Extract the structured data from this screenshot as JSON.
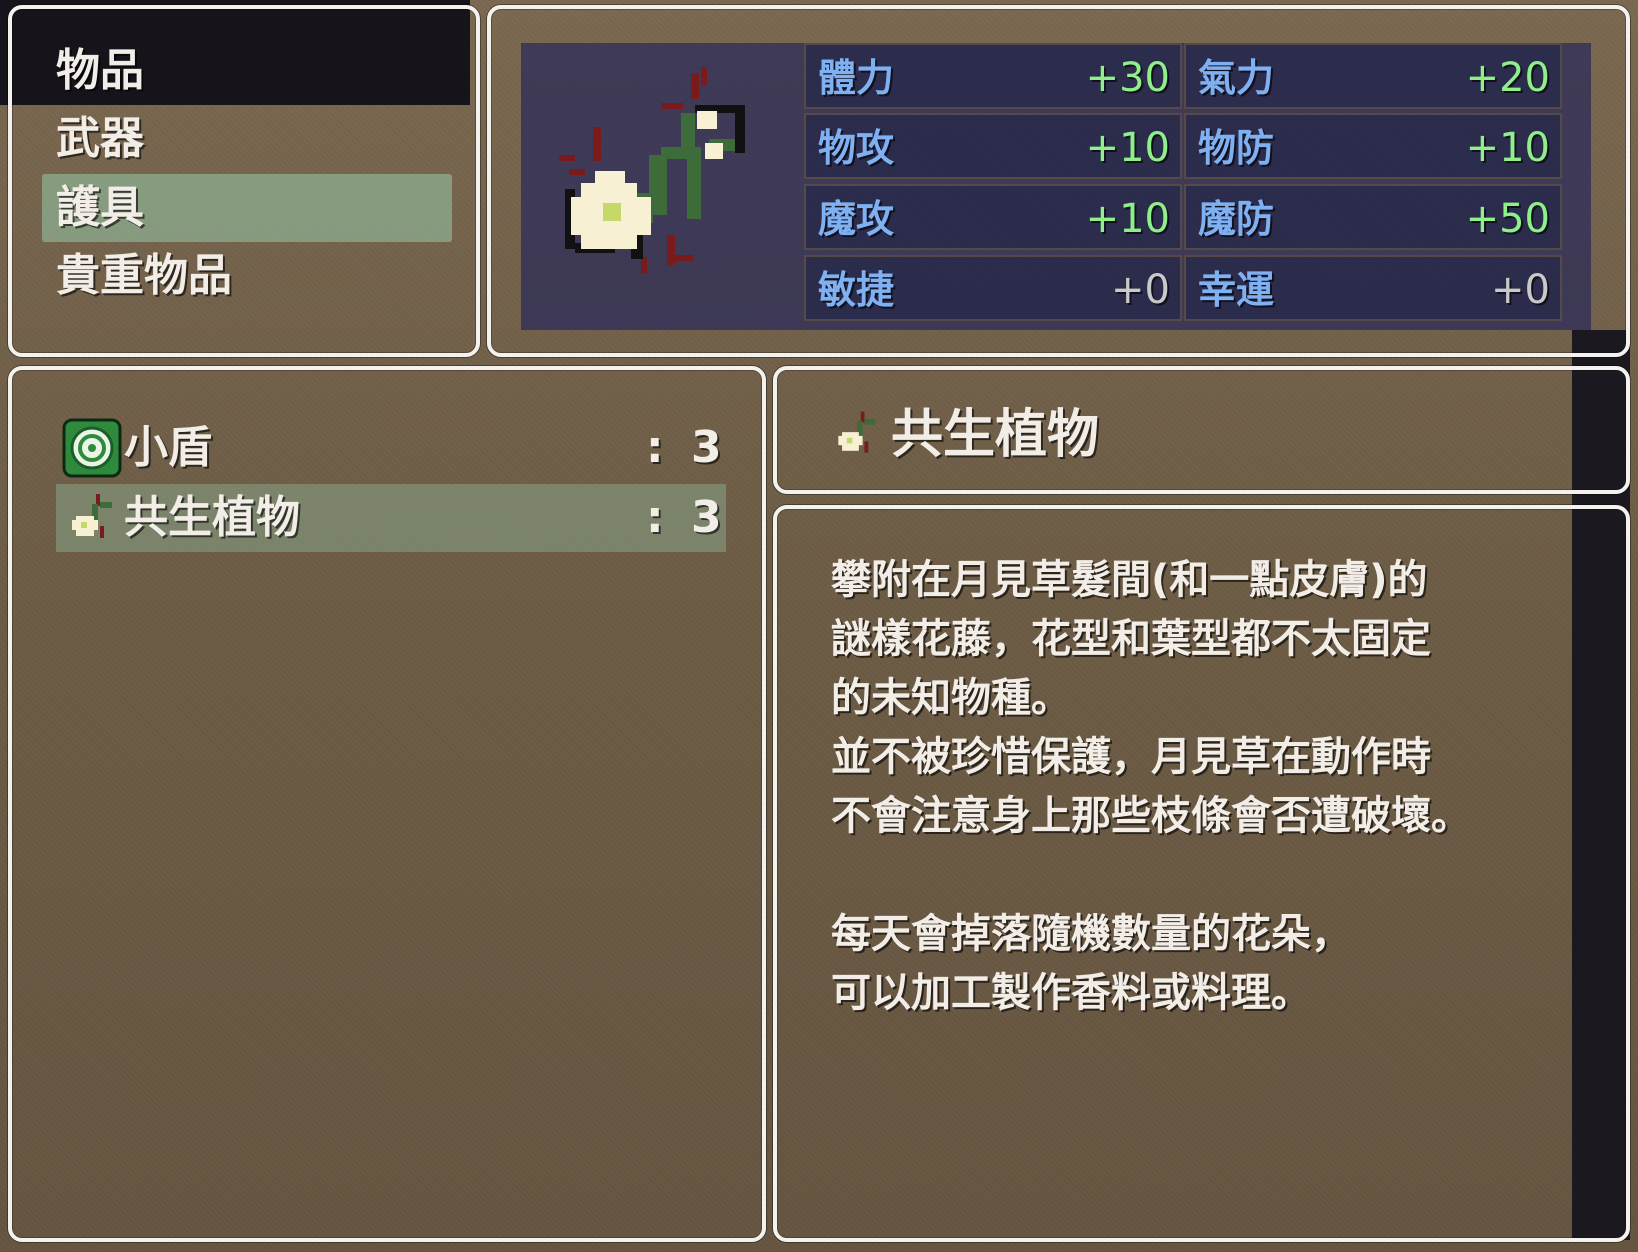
{
  "categories": {
    "items": [
      "物品",
      "武器",
      "護具",
      "貴重物品"
    ],
    "selected_index": 2
  },
  "stats": [
    {
      "name": "體力",
      "value": "+30"
    },
    {
      "name": "氣力",
      "value": "+20"
    },
    {
      "name": "物攻",
      "value": "+10"
    },
    {
      "name": "物防",
      "value": "+10"
    },
    {
      "name": "魔攻",
      "value": "+10"
    },
    {
      "name": "魔防",
      "value": "+50"
    },
    {
      "name": "敏捷",
      "value": "+0"
    },
    {
      "name": "幸運",
      "value": "+0"
    }
  ],
  "item_list": {
    "rows": [
      {
        "name": "小盾",
        "colon": ":",
        "count": "3",
        "icon": "shield-icon"
      },
      {
        "name": "共生植物",
        "colon": ":",
        "count": "3",
        "icon": "flower-vine-icon"
      }
    ],
    "selected_index": 1
  },
  "item_name": {
    "icon": "flower-vine-icon",
    "text": "共生植物"
  },
  "description": {
    "lines": [
      "攀附在月見草髮間(和一點皮膚)的",
      "謎樣花藤，花型和葉型都不太固定",
      "的未知物種。",
      "並不被珍惜保護，月見草在動作時",
      "不會注意身上那些枝條會否遭破壞。",
      "",
      "每天會掉落隨機數量的花朵，",
      "可以加工製作香料或料理。"
    ]
  },
  "colors": {
    "stat_label": "#7fb0f2",
    "stat_positive": "#8ff08a",
    "stat_zero": "#c9c9c9",
    "selection": "#8fb89a"
  }
}
